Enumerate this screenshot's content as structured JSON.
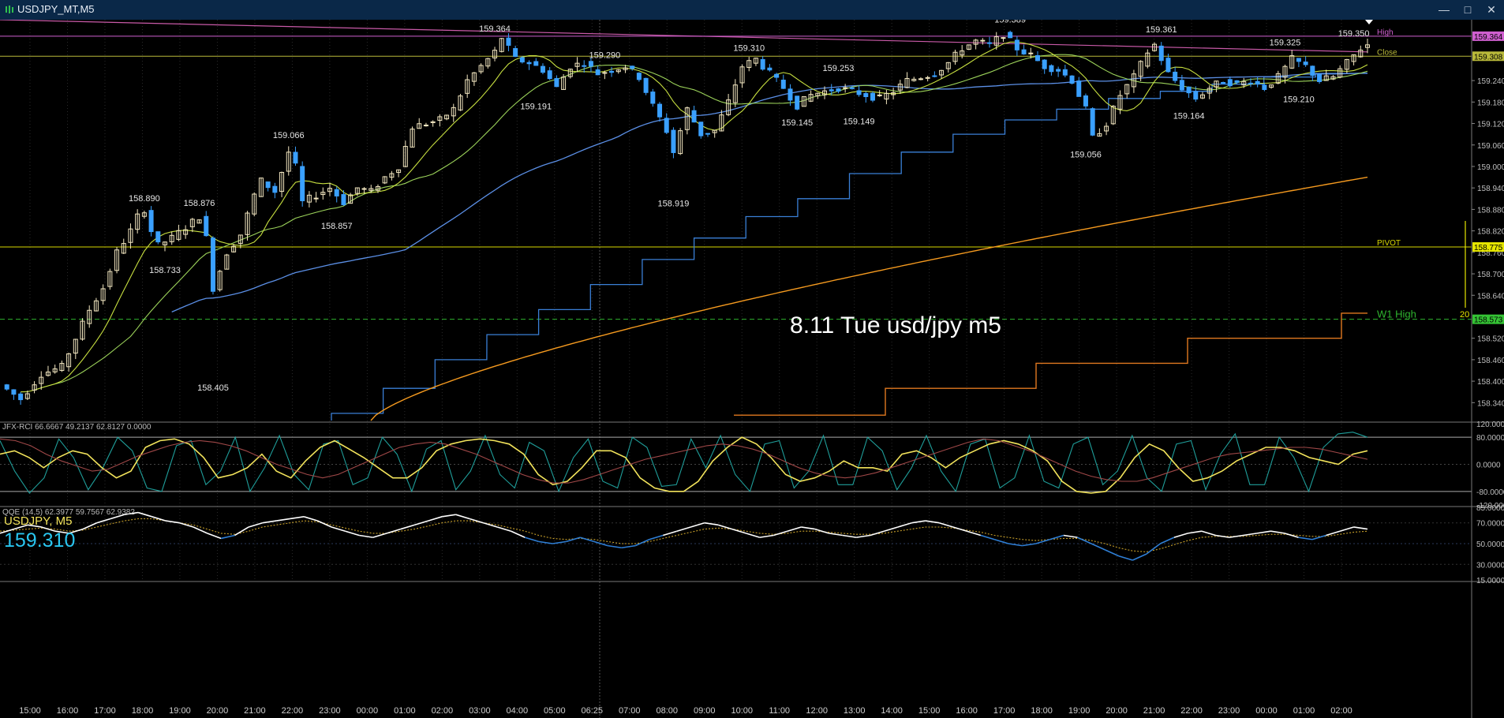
{
  "window": {
    "title": "USDJPY_MT,M5",
    "minimize_icon": "minimize-icon",
    "maximize_icon": "maximize-icon",
    "close_icon": "close-icon"
  },
  "annotation": "8.11 Tue usd/jpy m5",
  "chart_data": [
    {
      "type": "candlestick",
      "panel": "price",
      "symbol": "USDJPY",
      "timeframe": "M5",
      "ylim": [
        158.29,
        159.41
      ],
      "y_ticks": [
        "159.364",
        "159.308",
        "159.240",
        "159.180",
        "159.120",
        "159.060",
        "159.000",
        "158.940",
        "158.880",
        "158.820",
        "158.775",
        "158.760",
        "158.700",
        "158.640",
        "158.573",
        "158.520",
        "158.460",
        "158.400",
        "158.340"
      ],
      "x_ticks": [
        "15:00",
        "16:00",
        "17:00",
        "18:00",
        "19:00",
        "20:00",
        "21:00",
        "22:00",
        "23:00",
        "00:00",
        "01:00",
        "02:00",
        "03:00",
        "04:00",
        "05:00",
        "06:25",
        "07:00",
        "08:00",
        "09:00",
        "10:00",
        "11:00",
        "12:00",
        "13:00",
        "14:00",
        "15:00",
        "16:00",
        "17:00",
        "18:00",
        "19:00",
        "20:00",
        "21:00",
        "22:00",
        "23:00",
        "00:00",
        "01:00",
        "02:00"
      ],
      "close_path": [
        [
          0,
          158.39
        ],
        [
          3,
          158.35
        ],
        [
          6,
          158.42
        ],
        [
          9,
          158.44
        ],
        [
          11,
          158.52
        ],
        [
          13,
          158.6
        ],
        [
          15,
          158.66
        ],
        [
          17,
          158.76
        ],
        [
          19,
          158.82
        ],
        [
          20,
          158.86
        ],
        [
          21,
          158.88
        ],
        [
          22,
          158.82
        ],
        [
          23,
          158.78
        ],
        [
          25,
          158.8
        ],
        [
          27,
          158.83
        ],
        [
          29,
          158.86
        ],
        [
          30,
          158.8
        ],
        [
          31,
          158.66
        ],
        [
          33,
          158.76
        ],
        [
          35,
          158.81
        ],
        [
          37,
          158.92
        ],
        [
          38,
          158.96
        ],
        [
          40,
          158.93
        ],
        [
          42,
          159.04
        ],
        [
          43,
          159.0
        ],
        [
          44,
          158.9
        ],
        [
          46,
          158.92
        ],
        [
          48,
          158.94
        ],
        [
          50,
          158.9
        ],
        [
          52,
          158.94
        ],
        [
          54,
          158.93
        ],
        [
          56,
          158.97
        ],
        [
          58,
          159.0
        ],
        [
          60,
          159.11
        ],
        [
          62,
          159.12
        ],
        [
          64,
          159.13
        ],
        [
          66,
          159.16
        ],
        [
          68,
          159.24
        ],
        [
          70,
          159.28
        ],
        [
          72,
          159.32
        ],
        [
          73,
          159.36
        ],
        [
          75,
          159.3
        ],
        [
          77,
          159.29
        ],
        [
          79,
          159.27
        ],
        [
          81,
          159.22
        ],
        [
          83,
          159.28
        ],
        [
          85,
          159.29
        ],
        [
          87,
          159.26
        ],
        [
          89,
          159.27
        ],
        [
          91,
          159.28
        ],
        [
          93,
          159.25
        ],
        [
          95,
          159.17
        ],
        [
          97,
          159.1
        ],
        [
          98,
          159.04
        ],
        [
          100,
          159.16
        ],
        [
          102,
          159.09
        ],
        [
          104,
          159.1
        ],
        [
          106,
          159.18
        ],
        [
          108,
          159.28
        ],
        [
          110,
          159.3
        ],
        [
          112,
          159.26
        ],
        [
          114,
          159.22
        ],
        [
          116,
          159.17
        ],
        [
          118,
          159.2
        ],
        [
          120,
          159.21
        ],
        [
          122,
          159.22
        ],
        [
          124,
          159.21
        ],
        [
          126,
          159.2
        ],
        [
          128,
          159.19
        ],
        [
          130,
          159.21
        ],
        [
          132,
          159.24
        ],
        [
          134,
          159.25
        ],
        [
          136,
          159.26
        ],
        [
          138,
          159.29
        ],
        [
          140,
          159.33
        ],
        [
          142,
          159.35
        ],
        [
          144,
          159.34
        ],
        [
          146,
          159.37
        ],
        [
          148,
          159.33
        ],
        [
          150,
          159.31
        ],
        [
          152,
          159.28
        ],
        [
          154,
          159.27
        ],
        [
          156,
          159.24
        ],
        [
          158,
          159.16
        ],
        [
          159,
          159.08
        ],
        [
          161,
          159.12
        ],
        [
          163,
          159.2
        ],
        [
          165,
          159.25
        ],
        [
          167,
          159.32
        ],
        [
          168,
          159.34
        ],
        [
          170,
          159.26
        ],
        [
          172,
          159.22
        ],
        [
          174,
          159.19
        ],
        [
          176,
          159.22
        ],
        [
          178,
          159.24
        ],
        [
          180,
          159.23
        ],
        [
          182,
          159.24
        ],
        [
          184,
          159.22
        ],
        [
          186,
          159.25
        ],
        [
          188,
          159.3
        ],
        [
          190,
          159.28
        ],
        [
          192,
          159.24
        ],
        [
          194,
          159.25
        ],
        [
          196,
          159.29
        ],
        [
          198,
          159.33
        ],
        [
          199,
          159.34
        ]
      ],
      "data_labels": [
        {
          "value": "159.364",
          "pos": 72
        },
        {
          "value": "159.290",
          "pos": 88
        },
        {
          "value": "159.310",
          "pos": 109
        },
        {
          "value": "159.253",
          "pos": 122
        },
        {
          "value": "159.389",
          "pos": 147
        },
        {
          "value": "159.361",
          "pos": 169
        },
        {
          "value": "159.325",
          "pos": 187
        },
        {
          "value": "159.350",
          "pos": 197
        },
        {
          "value": "159.066",
          "pos": 42
        },
        {
          "value": "158.890",
          "pos": 21
        },
        {
          "value": "158.876",
          "pos": 29
        },
        {
          "value": "158.733",
          "pos": 24
        },
        {
          "value": "158.857",
          "pos": 49
        },
        {
          "value": "159.191",
          "pos": 78
        },
        {
          "value": "159.145",
          "pos": 116
        },
        {
          "value": "159.149",
          "pos": 125
        },
        {
          "value": "158.919",
          "pos": 98
        },
        {
          "value": "159.056",
          "pos": 158
        },
        {
          "value": "159.164",
          "pos": 173
        },
        {
          "value": "159.210",
          "pos": 189
        },
        {
          "value": "158.405",
          "pos": 31
        }
      ],
      "horizontal_lines": [
        {
          "name": "High",
          "value": 159.364,
          "color": "#d05fd0"
        },
        {
          "name": "Close",
          "value": 159.308,
          "color": "#b9b93a"
        },
        {
          "name": "PIVOT",
          "value": 158.775,
          "color": "#d8d800"
        },
        {
          "name": "W1 High",
          "value": 158.573,
          "color": "#2fb52f"
        }
      ],
      "price_badges": [
        {
          "text": "159.364",
          "bg": "#d05fd0",
          "fg": "#000"
        },
        {
          "text": "159.308",
          "bg": "#b9b93a",
          "fg": "#000"
        },
        {
          "text": "158.775",
          "bg": "#e6e600",
          "fg": "#000"
        },
        {
          "text": "158.573",
          "bg": "#35c435",
          "fg": "#000"
        }
      ],
      "side_marker": "20",
      "colors": {
        "bull": "#f2e6c0",
        "bear": "#3aa0ff",
        "ma_fast": "#c8e040",
        "ma_mid": "#9cd35a",
        "ma_slow": "#5b8fe6",
        "ma_long": "#f59a1f",
        "step_blue": "#3a7fd6",
        "step_orange": "#e0781f",
        "descending": "#c95aa8"
      }
    },
    {
      "type": "line",
      "panel": "rci",
      "label": "JFX-RCI 66.6667 49.2137 62.8127 0.0000",
      "y_ticks": [
        "120.0000",
        "80.0000",
        "0.0000",
        "-80.0000",
        "-120.0000"
      ],
      "ylim": [
        -120,
        120
      ],
      "series": [
        {
          "name": "fast",
          "color": "#1f9e9a",
          "values": [
            70,
            -20,
            -85,
            -40,
            75,
            20,
            -75,
            -10,
            80,
            40,
            -70,
            -80,
            55,
            70,
            -60,
            -20,
            80,
            -80,
            -10,
            85,
            -30,
            -75,
            60,
            70,
            -60,
            -40,
            80,
            30,
            -80,
            45,
            70,
            -75,
            -20,
            85,
            -30,
            -70,
            65,
            40,
            -80,
            20,
            75,
            -50,
            -70,
            80,
            50,
            -65,
            -60,
            75,
            -10,
            85,
            -30,
            -80,
            60,
            70,
            -70,
            -20,
            85,
            -60,
            -60,
            80,
            40,
            -75,
            -10,
            85,
            -20,
            -80,
            60,
            75,
            -70,
            -40,
            85,
            -50,
            -70,
            60,
            80,
            -60,
            -20,
            85,
            -40,
            -80,
            60,
            70,
            -75,
            30,
            90,
            -60,
            -60,
            80,
            20,
            -80,
            50,
            90,
            95,
            80
          ]
        },
        {
          "name": "mid",
          "color": "#f2e35b",
          "values": [
            30,
            40,
            20,
            -10,
            20,
            40,
            30,
            -10,
            -40,
            -20,
            50,
            70,
            75,
            60,
            20,
            -40,
            -30,
            -10,
            30,
            -20,
            -40,
            10,
            50,
            70,
            45,
            20,
            -10,
            -40,
            -40,
            -10,
            40,
            60,
            70,
            75,
            70,
            60,
            30,
            -30,
            -60,
            -50,
            -10,
            40,
            40,
            20,
            -40,
            -70,
            -80,
            -80,
            -50,
            10,
            50,
            80,
            60,
            20,
            -30,
            -50,
            -40,
            -20,
            10,
            -10,
            -10,
            -20,
            30,
            40,
            20,
            -10,
            20,
            40,
            60,
            70,
            60,
            40,
            10,
            -50,
            -80,
            -85,
            -80,
            -40,
            20,
            60,
            40,
            -10,
            -50,
            -40,
            -20,
            10,
            30,
            50,
            50,
            40,
            20,
            10,
            0,
            30,
            40
          ]
        },
        {
          "name": "slow",
          "color": "#a04848",
          "values": [
            75,
            70,
            55,
            30,
            10,
            -5,
            -20,
            -15,
            5,
            25,
            40,
            55,
            65,
            70,
            65,
            55,
            40,
            20,
            0,
            -15,
            -30,
            -40,
            -30,
            -10,
            10,
            30,
            50,
            60,
            65,
            60,
            45,
            30,
            10,
            -10,
            -30,
            -45,
            -55,
            -55,
            -45,
            -30,
            -15,
            0,
            15,
            25,
            35,
            45,
            55,
            60,
            55,
            45,
            30,
            10,
            -10,
            -25,
            -35,
            -40,
            -35,
            -25,
            -10,
            5,
            20,
            35,
            50,
            65,
            75,
            70,
            55,
            40,
            20,
            0,
            -20,
            -35,
            -45,
            -50,
            -50,
            -40,
            -25,
            -10,
            5,
            20,
            30,
            35,
            40,
            45,
            50,
            50,
            45,
            35,
            25,
            15
          ]
        }
      ]
    },
    {
      "type": "line",
      "panel": "qqe",
      "label": "QQE (14,5) 62.3977 59.7567 62.9382",
      "overlay_symbol": "USDJPY, M5",
      "overlay_price": "159.310",
      "y_ticks": [
        "85.0000",
        "70.0000",
        "50.0000",
        "30.0000",
        "15.0000"
      ],
      "ylim": [
        15,
        85
      ],
      "series": [
        {
          "name": "qqe",
          "color": "#ffffff",
          "values": [
            60,
            64,
            68,
            66,
            62,
            60,
            64,
            70,
            74,
            78,
            80,
            76,
            72,
            70,
            66,
            60,
            55,
            58,
            66,
            70,
            72,
            74,
            76,
            72,
            66,
            62,
            58,
            56,
            60,
            64,
            68,
            72,
            76,
            78,
            74,
            70,
            66,
            62,
            56,
            52,
            50,
            52,
            56,
            52,
            48,
            46,
            48,
            54,
            58,
            62,
            66,
            70,
            68,
            64,
            60,
            56,
            58,
            62,
            66,
            64,
            60,
            58,
            56,
            58,
            62,
            66,
            70,
            72,
            70,
            66,
            62,
            58,
            54,
            50,
            48,
            50,
            54,
            58,
            56,
            50,
            44,
            38,
            34,
            40,
            50,
            56,
            60,
            62,
            58,
            56,
            58,
            60,
            62,
            60,
            56,
            54,
            58,
            62,
            66,
            64
          ]
        },
        {
          "name": "signal",
          "color": "#c8a02a",
          "values": [
            62,
            63,
            64,
            65,
            64,
            62,
            63,
            66,
            69,
            72,
            74,
            74,
            72,
            70,
            68,
            64,
            60,
            59,
            62,
            66,
            68,
            70,
            72,
            71,
            68,
            65,
            62,
            60,
            60,
            62,
            64,
            67,
            70,
            72,
            72,
            70,
            68,
            65,
            62,
            58,
            55,
            54,
            55,
            54,
            52,
            50,
            50,
            52,
            55,
            58,
            61,
            64,
            65,
            64,
            62,
            60,
            59,
            60,
            62,
            62,
            61,
            60,
            59,
            59,
            60,
            62,
            64,
            66,
            66,
            65,
            63,
            61,
            58,
            56,
            54,
            53,
            54,
            55,
            55,
            53,
            50,
            46,
            43,
            42,
            45,
            49,
            53,
            56,
            57,
            57,
            57,
            58,
            59,
            59,
            58,
            57,
            57,
            59,
            61,
            62
          ]
        }
      ]
    }
  ]
}
